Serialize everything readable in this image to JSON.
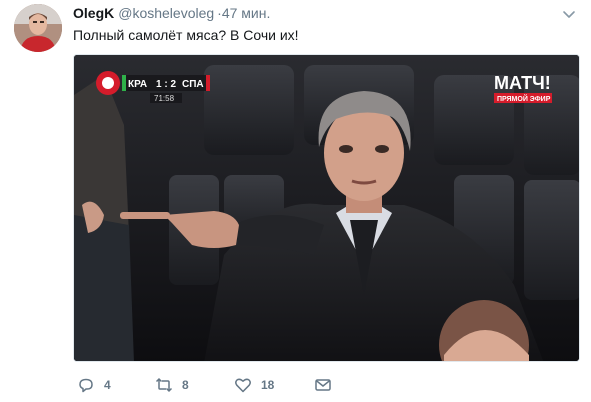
{
  "tweet": {
    "display_name": "OlegK",
    "handle": "@koshelevoleg",
    "dot": "·",
    "time": "47 мин.",
    "text": "Полный самолёт мяса? В Сочи их!"
  },
  "media": {
    "scoreboard": {
      "home": "КРА",
      "score": "1 : 2",
      "away": "СПА",
      "clock": "71:58"
    },
    "channel": {
      "name": "МАТЧ!",
      "subtitle": "ПРЯМОЙ ЭФИР"
    }
  },
  "actions": {
    "reply": {
      "icon": "reply-icon",
      "count": "4"
    },
    "retweet": {
      "icon": "retweet-icon",
      "count": "8"
    },
    "like": {
      "icon": "heart-icon",
      "count": "18"
    },
    "message": {
      "icon": "envelope-icon"
    }
  },
  "colors": {
    "text": "#14171a",
    "secondary": "#657786",
    "border": "#e1e8ed",
    "channel_red": "#d51c2b"
  }
}
